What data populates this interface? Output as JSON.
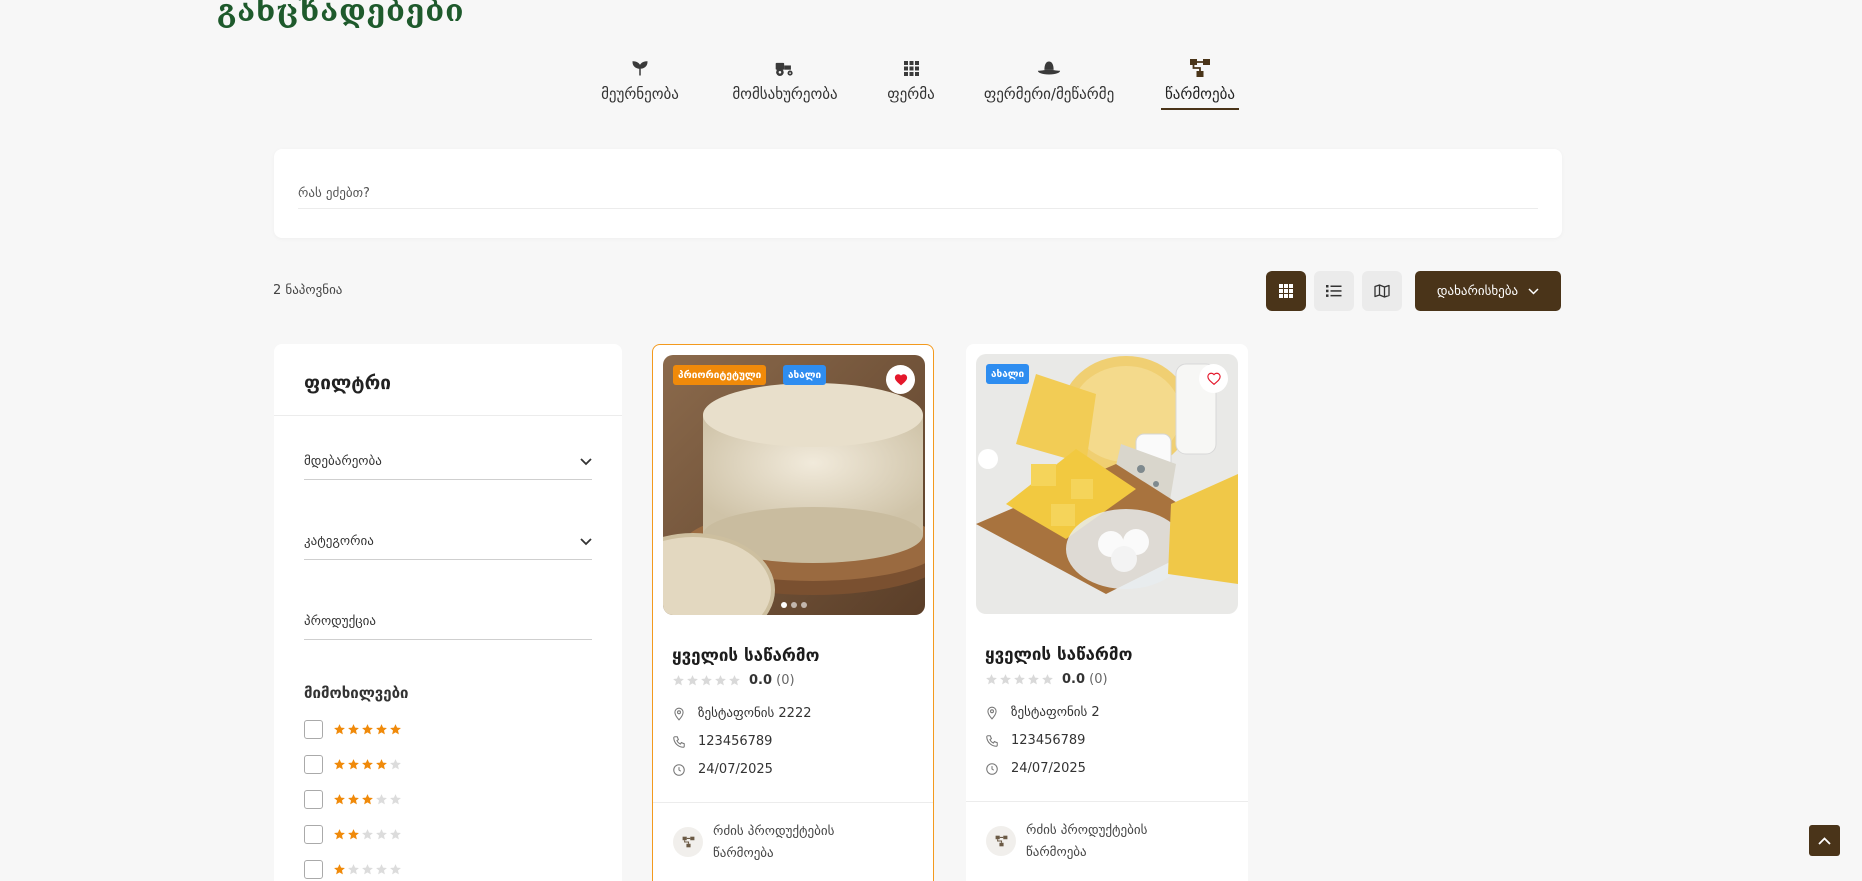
{
  "page": {
    "title": "განცხადებები"
  },
  "tabs": [
    {
      "label": "მეურნეობა",
      "icon": "sprout-icon"
    },
    {
      "label": "მომსახურეობა",
      "icon": "tractor-icon"
    },
    {
      "label": "ფერმა",
      "icon": "grid-icon"
    },
    {
      "label": "ფერმერი/მეწარმე",
      "icon": "farmer-hat-icon"
    },
    {
      "label": "წარმოება",
      "icon": "production-icon",
      "active": true
    }
  ],
  "search": {
    "placeholder": "რას ეძებთ?",
    "value": ""
  },
  "results": {
    "count_label": "2 ნაპოვნია"
  },
  "view_options": [
    "grid",
    "list",
    "map"
  ],
  "sort": {
    "label": "დახარისხება"
  },
  "filter": {
    "title": "ფილტრი",
    "location": "მდებარეობა",
    "category": "კატეგორია",
    "product": "პროდუქცია",
    "reviews_title": "მიმოხილვები",
    "ratings": [
      5,
      4,
      3,
      2,
      1
    ]
  },
  "listings": [
    {
      "badges": [
        {
          "label": "პრიორიტეტული",
          "color": "#f08a0a"
        },
        {
          "label": "ახალი",
          "color": "#2e8df0"
        }
      ],
      "favorited": true,
      "title": "ყველის საწარმო",
      "rating": "0.0",
      "reviews": "(0)",
      "address": "ზესტაფონის 2222",
      "phone": "123456789",
      "date": "24/07/2025",
      "category": "რძის პროდუქტების წარმოება",
      "slide_count": 3,
      "active_slide": 1,
      "highlighted": true
    },
    {
      "badges": [
        {
          "label": "ახალი",
          "color": "#2e8df0"
        }
      ],
      "favorited": false,
      "title": "ყველის საწარმო",
      "rating": "0.0",
      "reviews": "(0)",
      "address": "ზესტაფონის 2",
      "phone": "123456789",
      "date": "24/07/2025",
      "category": "რძის პროდუქტების წარმოება",
      "slide_count": 0,
      "active_slide": 0,
      "highlighted": false
    }
  ],
  "colors": {
    "brand": "#4a3419",
    "title_green": "#1e5a2c",
    "star": "#f08a0a",
    "badge_priority": "#f08a0a",
    "badge_new": "#2e8df0",
    "favorite": "#e4172b"
  }
}
